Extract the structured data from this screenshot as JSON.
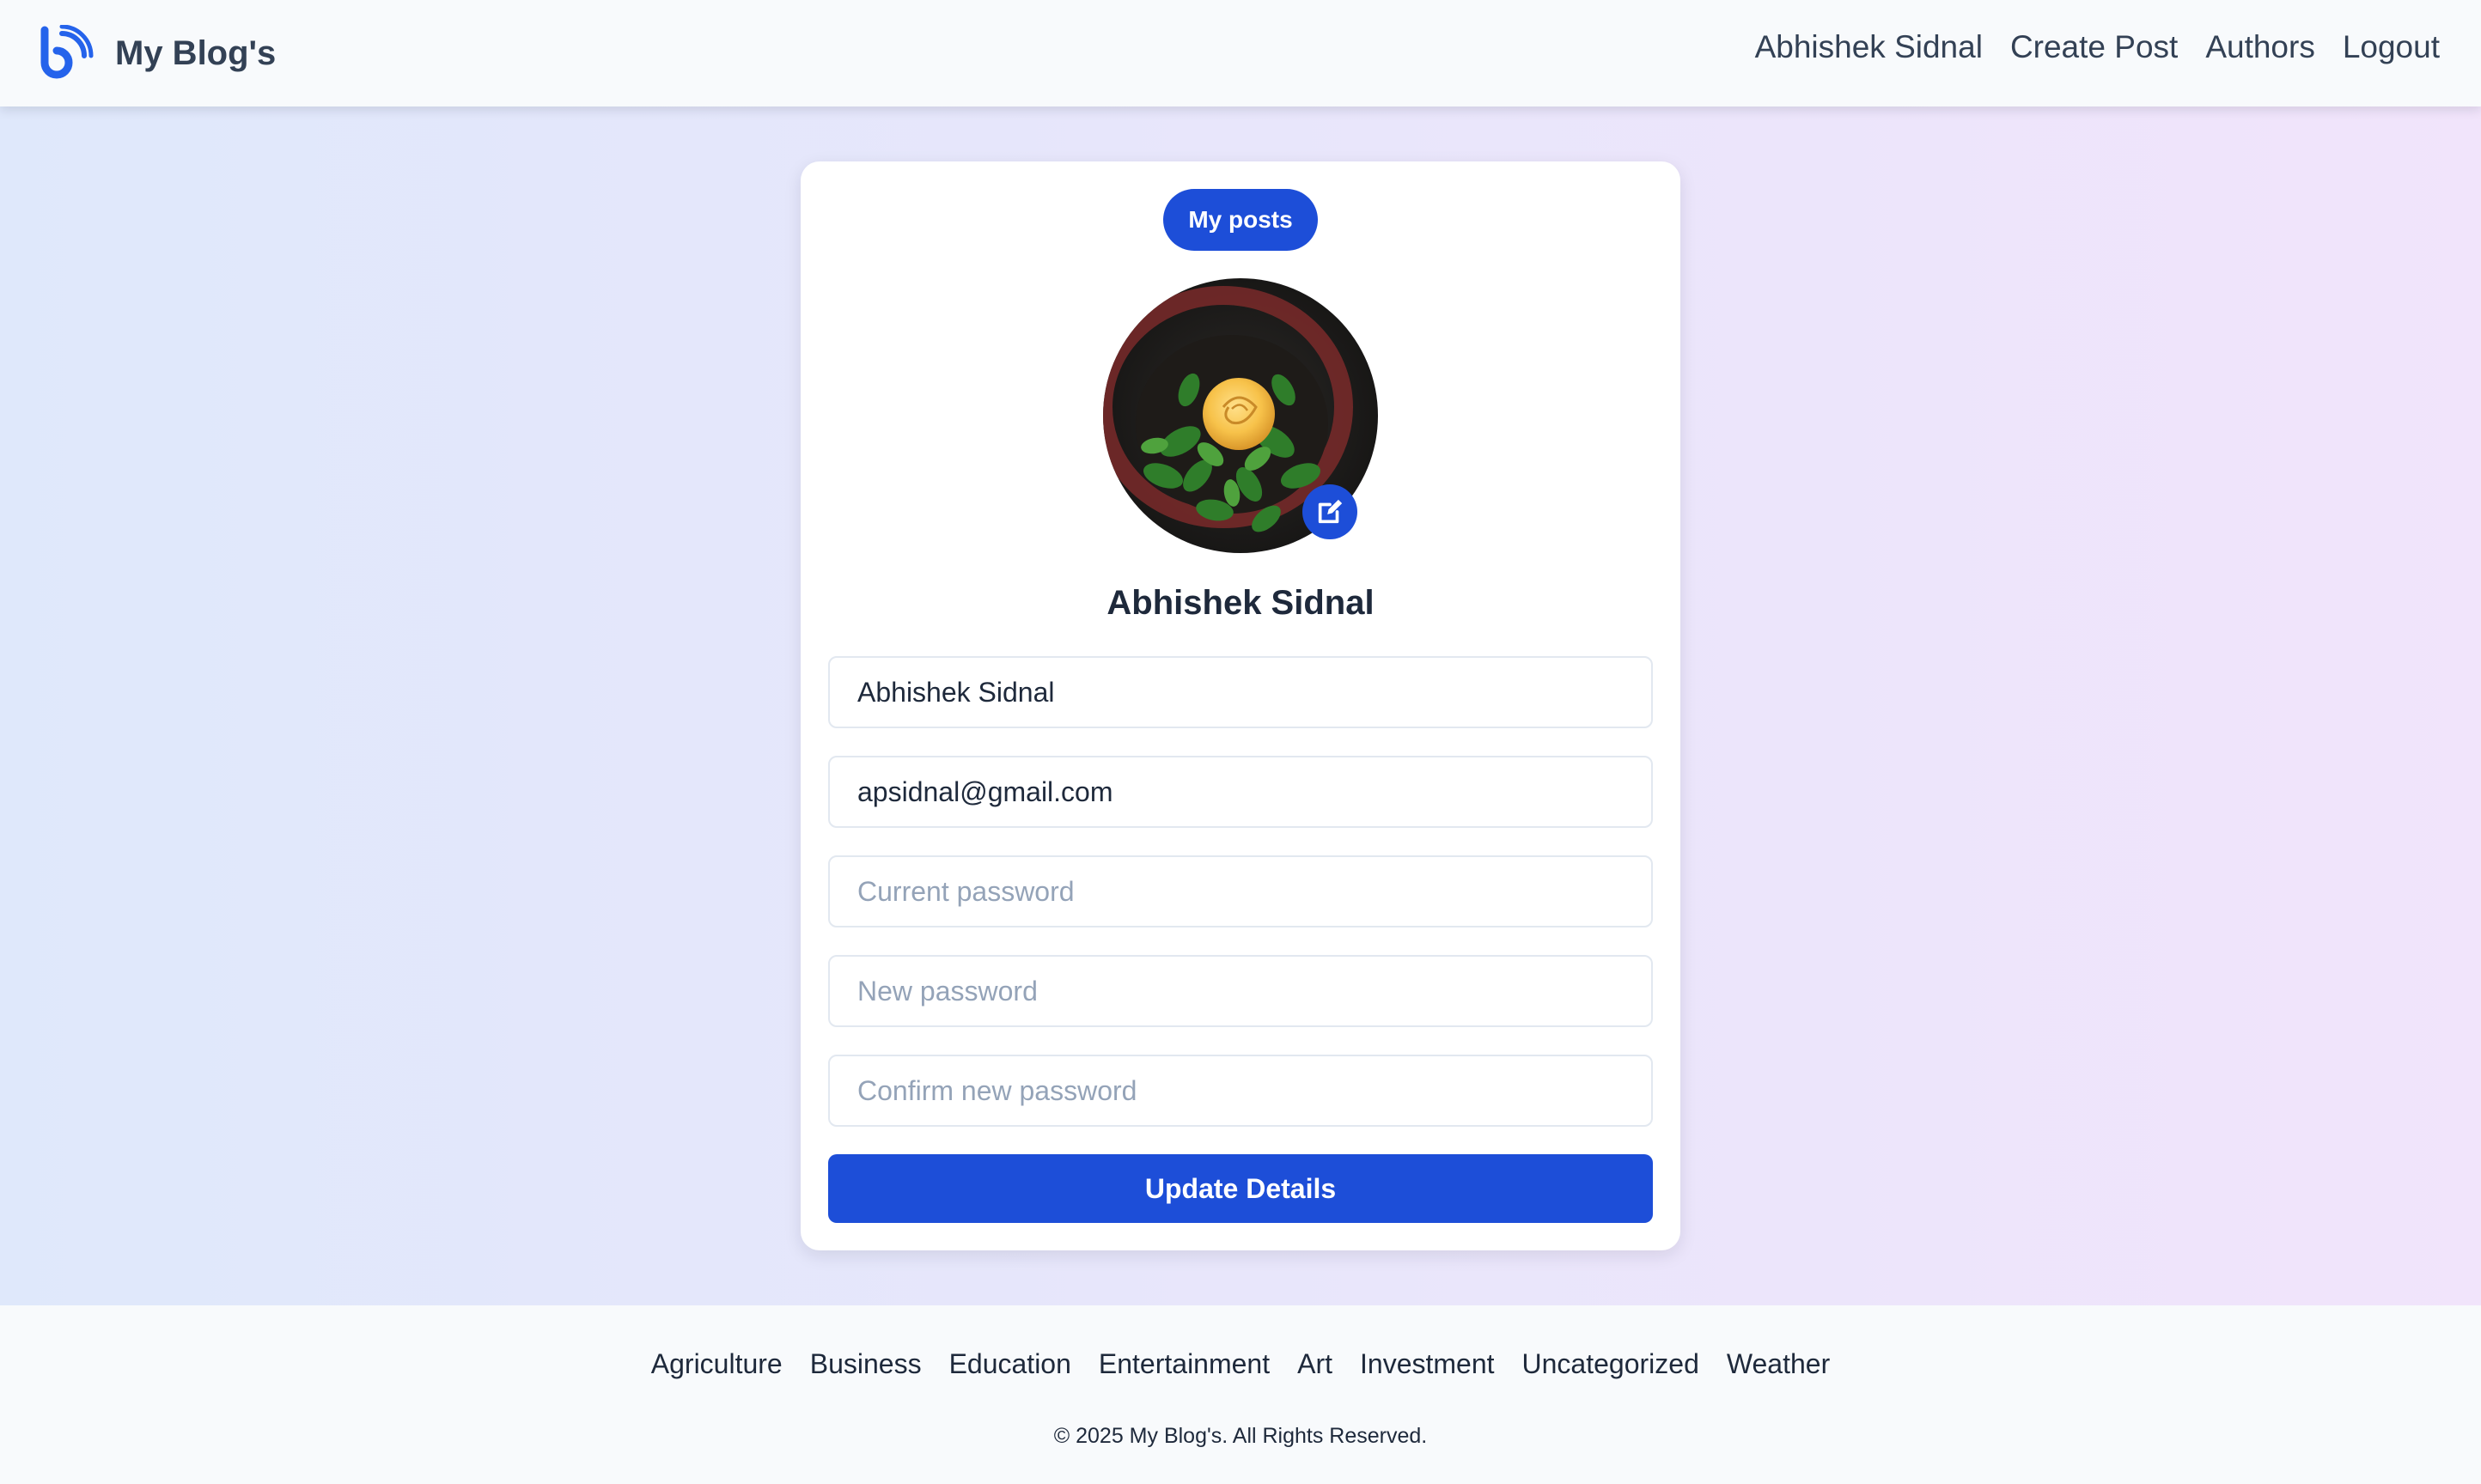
{
  "header": {
    "brand": "My Blog's",
    "logo_icon": "blog-logo-icon",
    "nav": [
      {
        "label": "Abhishek Sidnal"
      },
      {
        "label": "Create Post"
      },
      {
        "label": "Authors"
      },
      {
        "label": "Logout"
      }
    ]
  },
  "profile": {
    "my_posts_label": "My posts",
    "avatar_alt": "rose-flower-avatar",
    "edit_icon": "edit-icon",
    "name": "Abhishek Sidnal",
    "fields": {
      "name_value": "Abhishek Sidnal",
      "email_value": "apsidnal@gmail.com",
      "current_password_placeholder": "Current password",
      "new_password_placeholder": "New password",
      "confirm_password_placeholder": "Confirm new password"
    },
    "update_label": "Update Details"
  },
  "footer": {
    "categories": [
      {
        "label": "Agriculture"
      },
      {
        "label": "Business"
      },
      {
        "label": "Education"
      },
      {
        "label": "Entertainment"
      },
      {
        "label": "Art"
      },
      {
        "label": "Investment"
      },
      {
        "label": "Uncategorized"
      },
      {
        "label": "Weather"
      }
    ],
    "copyright": "© 2025 My Blog's. All Rights Reserved."
  },
  "colors": {
    "accent": "#1d4ed8",
    "logo": "#2563eb",
    "text": "#1e293b"
  }
}
